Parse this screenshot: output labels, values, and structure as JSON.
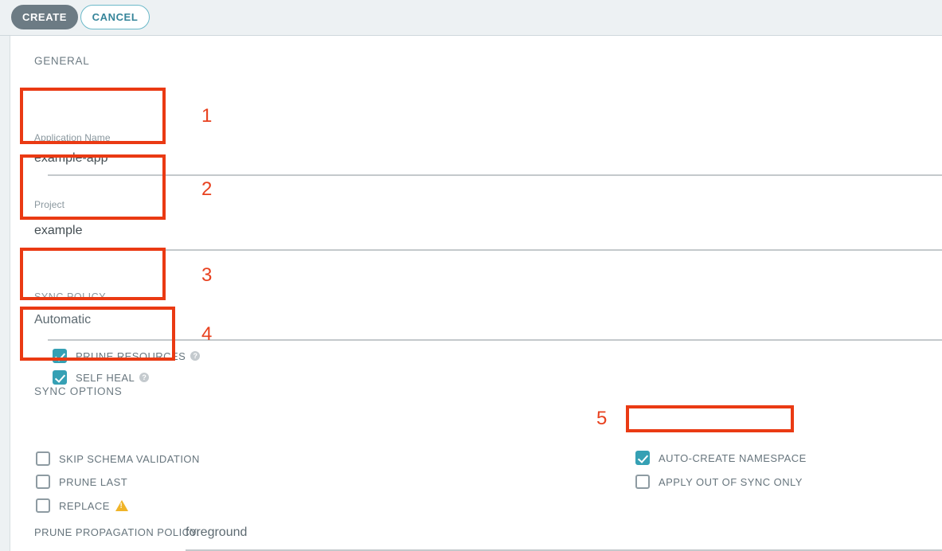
{
  "toolbar": {
    "create_label": "CREATE",
    "cancel_label": "CANCEL"
  },
  "sections": {
    "general_title": "GENERAL",
    "sync_options_title": "SYNC OPTIONS"
  },
  "fields": {
    "application_name": {
      "label": "Application Name",
      "value": "example-app"
    },
    "project": {
      "label": "Project",
      "value": "example"
    },
    "sync_policy": {
      "label": "SYNC POLICY",
      "value": "Automatic"
    },
    "prune_propagation_policy": {
      "label": "PRUNE PROPAGATION POLICY:",
      "value": "foreground"
    }
  },
  "policy_checkboxes": [
    {
      "label": "PRUNE RESOURCES",
      "checked": true,
      "help": "?"
    },
    {
      "label": "SELF HEAL",
      "checked": true,
      "help": "?"
    }
  ],
  "sync_options_left": [
    {
      "label": "SKIP SCHEMA VALIDATION",
      "checked": false
    },
    {
      "label": "PRUNE LAST",
      "checked": false
    },
    {
      "label": "REPLACE",
      "checked": false,
      "warning": true
    }
  ],
  "sync_options_right": [
    {
      "label": "AUTO-CREATE NAMESPACE",
      "checked": true
    },
    {
      "label": "APPLY OUT OF SYNC ONLY",
      "checked": false
    }
  ],
  "annotations": [
    {
      "number": "1"
    },
    {
      "number": "2"
    },
    {
      "number": "3"
    },
    {
      "number": "4"
    },
    {
      "number": "5"
    }
  ],
  "colors": {
    "accent_teal": "#35a0b4",
    "create_button": "#6c7b84",
    "annotation_red": "#ea3a13",
    "warning_amber": "#f0b428",
    "topbar_bg": "#edf1f3"
  }
}
